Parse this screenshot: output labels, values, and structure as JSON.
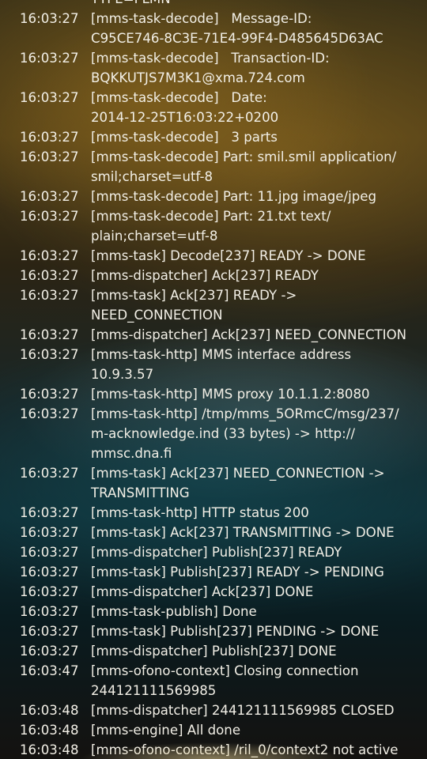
{
  "log": [
    {
      "time": "",
      "text": "TYPE=PLMN"
    },
    {
      "time": "16:03:27",
      "text": "[mms-task-decode]   Message-ID:\nC95CE746-8C3E-71E4-99F4-D485645D63AC"
    },
    {
      "time": "16:03:27",
      "text": "[mms-task-decode]   Transaction-ID:\nBQKKUTJS7M3K1@xma.724.com"
    },
    {
      "time": "16:03:27",
      "text": "[mms-task-decode]   Date:\n2014-12-25T16:03:22+0200"
    },
    {
      "time": "16:03:27",
      "text": "[mms-task-decode]   3 parts"
    },
    {
      "time": "16:03:27",
      "text": "[mms-task-decode] Part: smil.smil application/\nsmil;charset=utf-8"
    },
    {
      "time": "16:03:27",
      "text": "[mms-task-decode] Part: 11.jpg image/jpeg"
    },
    {
      "time": "16:03:27",
      "text": "[mms-task-decode] Part: 21.txt text/\nplain;charset=utf-8"
    },
    {
      "time": "16:03:27",
      "text": "[mms-task] Decode[237] READY -> DONE"
    },
    {
      "time": "16:03:27",
      "text": "[mms-dispatcher] Ack[237] READY"
    },
    {
      "time": "16:03:27",
      "text": "[mms-task] Ack[237] READY ->\nNEED_CONNECTION"
    },
    {
      "time": "16:03:27",
      "text": "[mms-dispatcher] Ack[237] NEED_CONNECTION"
    },
    {
      "time": "16:03:27",
      "text": "[mms-task-http] MMS interface address 10.9.3.57"
    },
    {
      "time": "16:03:27",
      "text": "[mms-task-http] MMS proxy 10.1.1.2:8080"
    },
    {
      "time": "16:03:27",
      "text": "[mms-task-http] /tmp/mms_5ORmcC/msg/237/\nm-acknowledge.ind (33 bytes) -> http://\nmmsc.dna.fi"
    },
    {
      "time": "16:03:27",
      "text": "[mms-task] Ack[237] NEED_CONNECTION ->\nTRANSMITTING"
    },
    {
      "time": "16:03:27",
      "text": "[mms-task-http] HTTP status 200"
    },
    {
      "time": "16:03:27",
      "text": "[mms-task] Ack[237] TRANSMITTING -> DONE"
    },
    {
      "time": "16:03:27",
      "text": "[mms-dispatcher] Publish[237] READY"
    },
    {
      "time": "16:03:27",
      "text": "[mms-task] Publish[237] READY -> PENDING"
    },
    {
      "time": "16:03:27",
      "text": "[mms-dispatcher] Ack[237] DONE"
    },
    {
      "time": "16:03:27",
      "text": "[mms-task-publish] Done"
    },
    {
      "time": "16:03:27",
      "text": "[mms-task] Publish[237] PENDING -> DONE"
    },
    {
      "time": "16:03:27",
      "text": "[mms-dispatcher] Publish[237] DONE"
    },
    {
      "time": "16:03:47",
      "text": "[mms-ofono-context] Closing connection\n244121111569985"
    },
    {
      "time": "16:03:48",
      "text": "[mms-dispatcher] 244121111569985 CLOSED"
    },
    {
      "time": "16:03:48",
      "text": "[mms-engine] All done"
    },
    {
      "time": "16:03:48",
      "text": "[mms-ofono-context] /ril_0/context2 not active"
    }
  ]
}
